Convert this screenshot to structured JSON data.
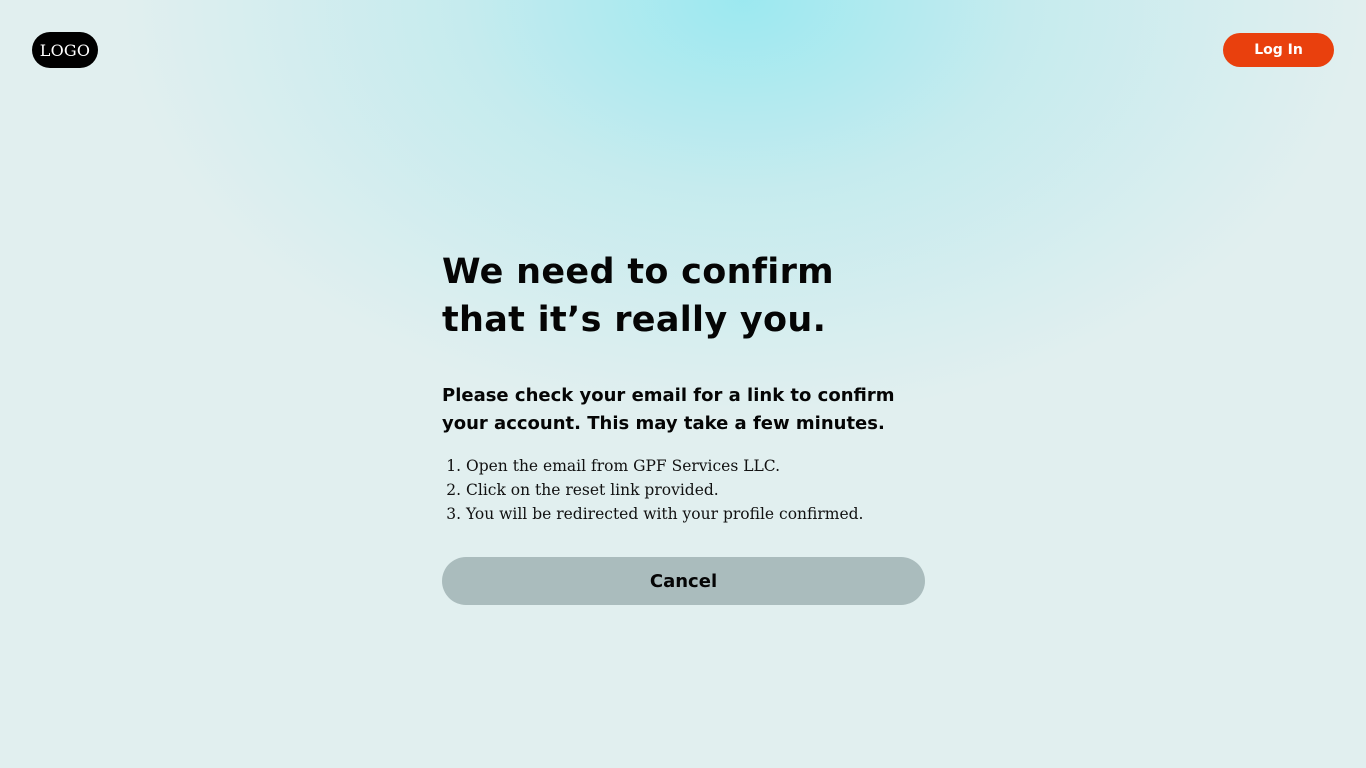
{
  "header": {
    "logo_text": "LOGO",
    "login_label": "Log In"
  },
  "main": {
    "title": "We need to confirm that it’s really you.",
    "subtitle": "Please check your email for a link to confirm your account. This may take a few minutes.",
    "steps": [
      "Open the email from GPF Services LLC.",
      "Click on the reset link provided.",
      "You will be redirected with your profile confirmed."
    ],
    "cancel_label": "Cancel"
  },
  "colors": {
    "accent": "#e9400d",
    "cancel_bg": "#aabcbd",
    "background": "#e1efef",
    "glow": "#9fe8ee",
    "text": "#050505"
  }
}
